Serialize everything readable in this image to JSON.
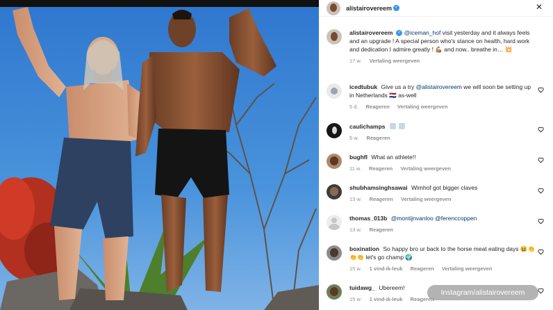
{
  "post": {
    "author": "alistairovereem",
    "more_icon": "more-horizontal-icon",
    "caption": {
      "username": "alistairovereem",
      "mention": "@iceman_hof",
      "text": " visit yesterday and it always feels and an upgrade ! A special person who's stance on health, hard work and dedication I admire greatly ! 💪🏽 and now.. breathe in… 💥",
      "time": "17 w.",
      "translate": "Vertaling weergeven"
    }
  },
  "comments": [
    {
      "username": "icedtubuk",
      "text": "Give us a try ",
      "mention": "@alistairovereem",
      "text_after": " we will soon be setting up in Netherlands 🇳🇱 as-well",
      "time": "5 d.",
      "reply": "Reageren",
      "translate": "Vertaling weergeven",
      "likes": ""
    },
    {
      "username": "caulichamps",
      "text": "🏽 🏽",
      "mention": "",
      "text_after": "",
      "time": "5 w.",
      "reply": "Reageren",
      "translate": "",
      "likes": ""
    },
    {
      "username": "bughfl",
      "text": "What an athlete!!",
      "mention": "",
      "text_after": "",
      "time": "11 w.",
      "reply": "Reageren",
      "translate": "Vertaling weergeven",
      "likes": ""
    },
    {
      "username": "shubhamsinghsawai",
      "text": "Wimhof got bigger claves",
      "mention": "",
      "text_after": "",
      "time": "13 w.",
      "reply": "Reageren",
      "translate": "Vertaling weergeven",
      "likes": ""
    },
    {
      "username": "thomas_013b",
      "text": "",
      "mention": "@montijnvanloo",
      "text_after": " ",
      "mention2": "@ferenccoppen",
      "time": "13 w.",
      "reply": "Reageren",
      "translate": "",
      "likes": ""
    },
    {
      "username": "boxination",
      "text": "So happy bro ur back to the horse meat eating days 😆👏👏👏 let's go champ 🌍",
      "mention": "",
      "text_after": "",
      "time": "15 w.",
      "reply": "Reageren",
      "translate": "Vertaling weergeven",
      "likes": "1 vind-ik-leuk"
    },
    {
      "username": "tuidawg_",
      "text": "Ubereem!",
      "mention": "",
      "text_after": "",
      "time": "15 w.",
      "reply": "Reageren",
      "translate": "",
      "likes": "1 vind-ik-leuk"
    }
  ],
  "watermark": "Instagram/alistairovereem",
  "colors": {
    "sky": "#3f86d6",
    "link": "#00376b",
    "verified": "#3897f0",
    "meta": "#8e8e8e"
  }
}
